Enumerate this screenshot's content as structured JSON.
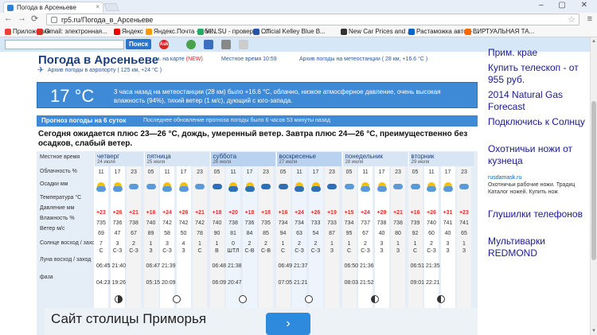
{
  "browser": {
    "tab_title": "Погода в Арсеньеве",
    "tab_close": "×",
    "window_controls": "– ▢ ✕",
    "url": "rp5.ru/Погода_в_Арсеньеве",
    "back": "←",
    "forward": "→",
    "reload": "⟳",
    "star": "☆",
    "menu": "≡",
    "bookmarks": [
      "Приложения",
      "Gmail: электронная...",
      "Яндекс",
      "Яндекс.Почта — бе...",
      "VIN.SU - проверка ...",
      "Official Kelley Blue B...",
      "New Car Prices and ...",
      "Растаможка авто – ...",
      "ВИРТУАЛЬНАЯ ТА..."
    ]
  },
  "site": {
    "search_button": "Поиск",
    "ask_label": "Ask"
  },
  "header": {
    "title": "Погода в Арсеньеве",
    "map_link": "см. на карте",
    "map_new": "(NEW)",
    "local_time": "Местное время 10:59",
    "archive_station": "Архив погоды на метеостанции ( 28 км, +16.6 °C )",
    "archive_airport": "Архив погоды в аэропорту ( 125 км, +24 °C )"
  },
  "current": {
    "temp": "17 °C",
    "description": "3 часа назад на метеостанции (28 км) было +16.6 °C, облачно, низкое атмосферное давление, очень высокая влажность (94%), тихий ветер (1 м/с), дующий с юго-запада."
  },
  "forecast": {
    "header": "Прогноз погоды на 6 суток",
    "updated": "Последнее обновление прогноза погоды было 6 часов 53 минуты назад",
    "summary": "Сегодня ожидается плюс 23—26 °C, дождь, умеренный ветер. Завтра плюс 24—26 °C, преимущественно без осадков, слабый ветер.",
    "row_labels": [
      "Местное время",
      "Облачность %",
      "Осадки мм",
      "Температура °C",
      "Давление мм",
      "Влажность %",
      "Ветер м/с",
      "Солнце восход / заход",
      "Луна восход / заход",
      "фаза"
    ],
    "days": [
      {
        "name": "четверг",
        "date": "24 июля",
        "weekend": false,
        "hours": [
          "11",
          "17",
          "23"
        ],
        "temps": [
          "+23",
          "+26",
          "+21"
        ],
        "pressure": [
          "735",
          "736",
          "738"
        ],
        "humidity": [
          "69",
          "47",
          "67"
        ],
        "wind": [
          "7",
          "3",
          "2"
        ],
        "wind_dir": [
          "С",
          "С-З",
          "С-З"
        ],
        "sun": "06:45 21:40",
        "moon": "04:23 19:26",
        "phase": "cres"
      },
      {
        "name": "пятница",
        "date": "25 июля",
        "weekend": false,
        "hours": [
          "05",
          "11",
          "17",
          "23"
        ],
        "temps": [
          "+16",
          "+24",
          "+26",
          "+21"
        ],
        "pressure": [
          "740",
          "742",
          "742",
          "742"
        ],
        "humidity": [
          "89",
          "58",
          "50",
          "78"
        ],
        "wind": [
          "1",
          "3",
          "4",
          "1"
        ],
        "wind_dir": [
          "З",
          "С-З",
          "З",
          "С"
        ],
        "sun": "06:47 21:39",
        "moon": "05:15 20:09",
        "phase": "new"
      },
      {
        "name": "суббота",
        "date": "26 июля",
        "weekend": true,
        "hours": [
          "05",
          "11",
          "17",
          "23"
        ],
        "temps": [
          "+18",
          "+20",
          "+18",
          "+18"
        ],
        "pressure": [
          "740",
          "738",
          "736",
          "735"
        ],
        "humidity": [
          "90",
          "81",
          "84",
          "85"
        ],
        "wind": [
          "1",
          "0",
          "2",
          "2"
        ],
        "wind_dir": [
          "В",
          "ШТЛ",
          "С-В",
          "С-В"
        ],
        "sun": "06:48 21:38",
        "moon": "06:09 20:47",
        "phase": "new"
      },
      {
        "name": "воскресенье",
        "date": "27 июля",
        "weekend": true,
        "hours": [
          "05",
          "11",
          "17",
          "23"
        ],
        "temps": [
          "+16",
          "+24",
          "+26",
          "+19"
        ],
        "pressure": [
          "734",
          "734",
          "733",
          "733"
        ],
        "humidity": [
          "94",
          "63",
          "54",
          "87"
        ],
        "wind": [
          "1",
          "2",
          "2",
          "1"
        ],
        "wind_dir": [
          "С",
          "С-З",
          "С-З",
          "З"
        ],
        "sun": "06:49 21:37",
        "moon": "07:05 21:21",
        "phase": "new"
      },
      {
        "name": "понедельник",
        "date": "28 июля",
        "weekend": false,
        "hours": [
          "05",
          "11",
          "17",
          "23"
        ],
        "temps": [
          "+15",
          "+24",
          "+29",
          "+21"
        ],
        "pressure": [
          "734",
          "737",
          "738",
          "738"
        ],
        "humidity": [
          "95",
          "67",
          "40",
          "80"
        ],
        "wind": [
          "1",
          "2",
          "3",
          "1"
        ],
        "wind_dir": [
          "С",
          "С-З",
          "З",
          "З"
        ],
        "sun": "06:50 21:36",
        "moon": "08:03 21:52",
        "phase": "half"
      },
      {
        "name": "вторник",
        "date": "29 июля",
        "weekend": false,
        "hours": [
          "05",
          "11",
          "17",
          "23"
        ],
        "temps": [
          "+16",
          "+26",
          "+31",
          "+23"
        ],
        "pressure": [
          "739",
          "740",
          "741",
          "741"
        ],
        "humidity": [
          "92",
          "60",
          "40",
          "65"
        ],
        "wind": [
          "1",
          "2",
          "3",
          "1"
        ],
        "wind_dir": [
          "С",
          "С-З",
          "З",
          "З"
        ],
        "sun": "06:51 21:35",
        "moon": "09:01 22:21",
        "phase": "half"
      }
    ]
  },
  "ads": {
    "items": [
      "Прим. крае",
      "Купить телескоп - от 955 руб.",
      "2014 Natural Gas Forecast",
      "Подключись к Солнцу",
      "Охотничьи ножи от кузнеца"
    ],
    "domain": "rusdamask.ru",
    "small_text": "Охотничьи рабочие ножи. Традиц Каталог ножей. Купить нож",
    "items2": [
      "Глушилки телефонов",
      "Мультиварки REDMOND"
    ]
  },
  "banner": {
    "text": "Сайт столицы Приморья",
    "button": "›"
  }
}
